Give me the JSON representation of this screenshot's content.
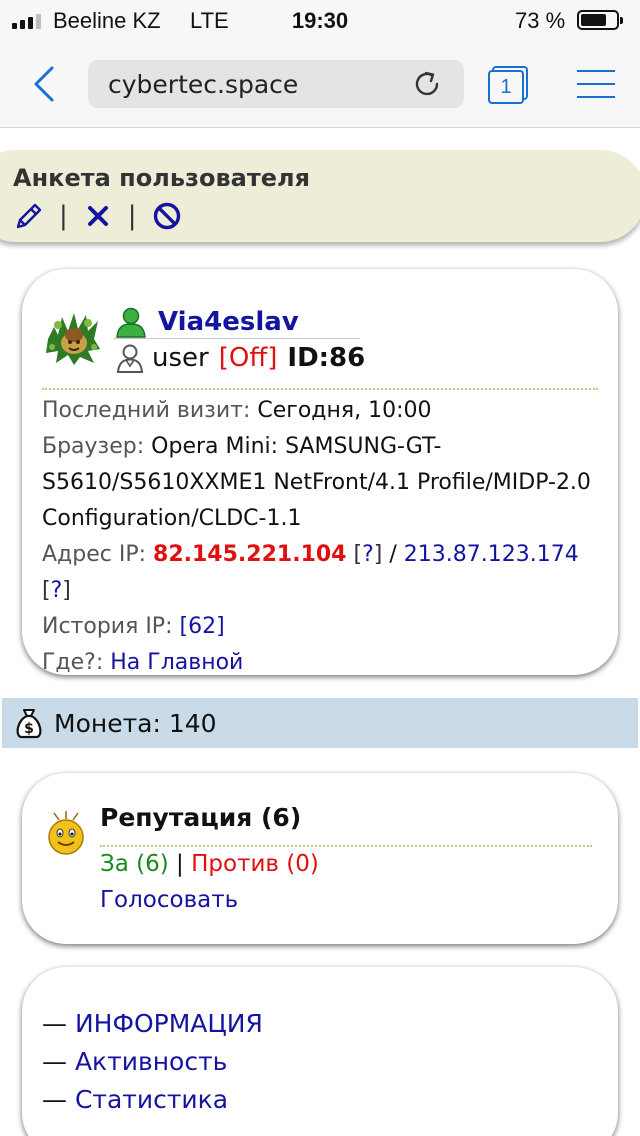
{
  "status_bar": {
    "carrier": "Beeline KZ",
    "network": "LTE",
    "time": "19:30",
    "battery": "73 %",
    "battery_level": 0.73
  },
  "browser": {
    "url": "cybertec.space",
    "tab_count": "1"
  },
  "header": {
    "title": "Анкета пользователя",
    "separator": "|",
    "icons": [
      "edit-icon",
      "close-icon",
      "ban-icon"
    ]
  },
  "profile": {
    "nickname": "Via4eslav",
    "role": "user",
    "status": "[Off]",
    "id": "ID:86",
    "last_visit_label": "Последний визит:",
    "last_visit_value": "Сегодня, 10:00",
    "browser_label": "Браузер:",
    "browser_value": "Opera Mini: SAMSUNG-GT-S5610/S5610XXME1 NetFront/4.1 Profile/MIDP-2.0 Configuration/CLDC-1.1",
    "ip_label": "Адрес IP:",
    "ip_primary": "82.145.221.104",
    "ip_lookup_1": "?",
    "ip_separator": "/",
    "ip_secondary": "213.87.123.174",
    "ip_lookup_2": "?",
    "ip_history_label": "История IP:",
    "ip_history_value": "[62]",
    "where_label": "Где?:",
    "where_value": "На Главной"
  },
  "coins": {
    "label": "Монета: 140"
  },
  "reputation": {
    "title": "Репутация (6)",
    "for_label": "За (6)",
    "separator": "|",
    "against_label": "Против (0)",
    "vote_link": "Голосовать"
  },
  "links": {
    "dash": "—",
    "items": [
      "ИНФОРМАЦИЯ",
      "Активность",
      "Статистика"
    ]
  },
  "colors": {
    "link_blue": "#1414a0",
    "alert_red": "#e01010",
    "positive_green": "#1a8a1a",
    "browser_accent": "#1a6fd6",
    "header_bg": "#eeeed8",
    "coin_bar_bg": "#c9dbe8"
  }
}
